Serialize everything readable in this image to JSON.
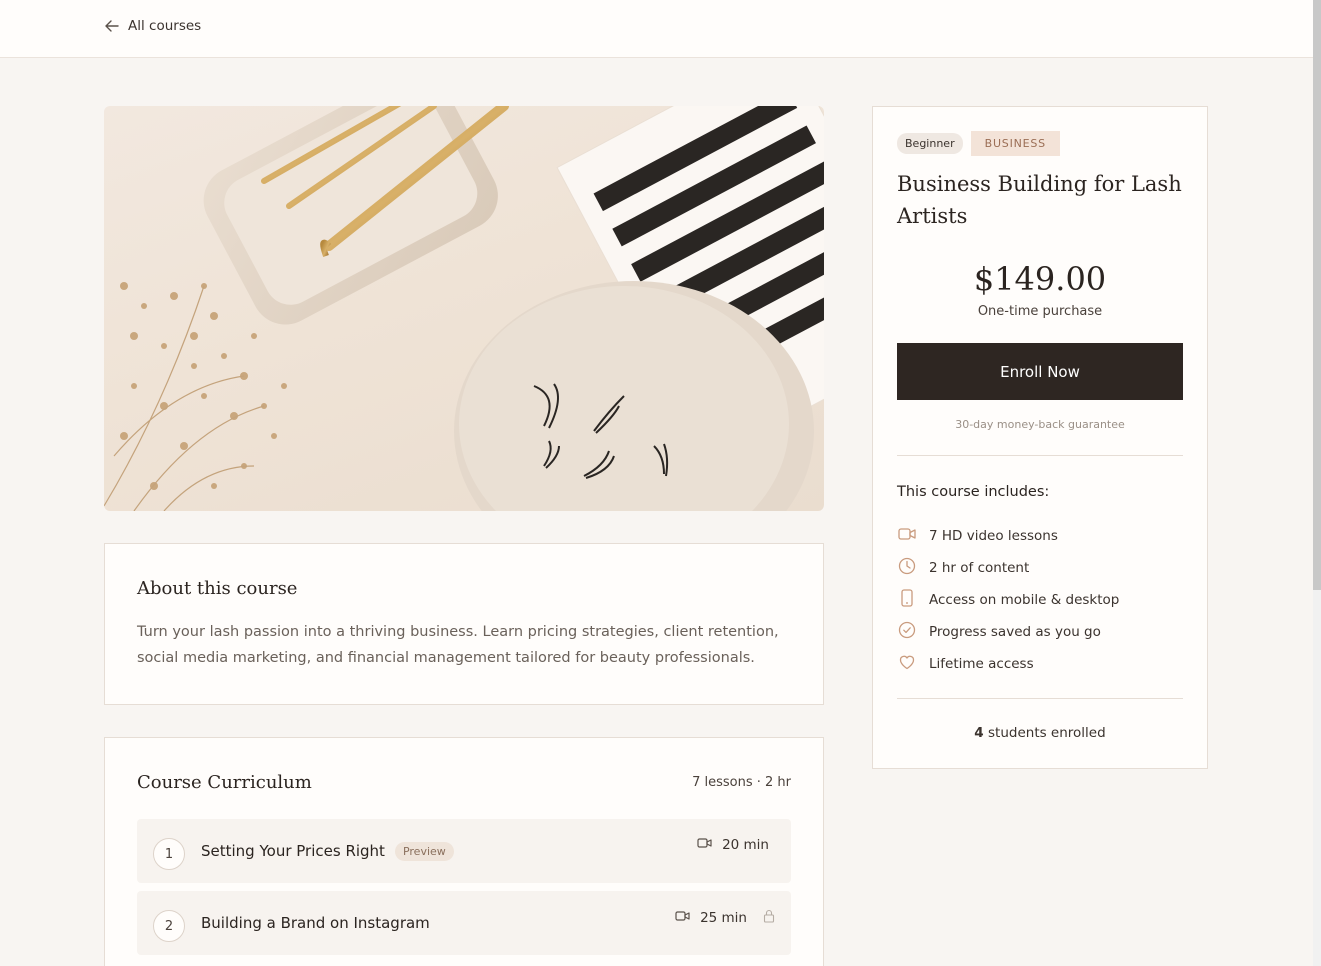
{
  "nav": {
    "back_label": "All courses"
  },
  "about": {
    "heading": "About this course",
    "description": "Turn your lash passion into a thriving business. Learn pricing strategies, client retention, social media marketing, and financial management tailored for beauty professionals."
  },
  "curriculum": {
    "heading": "Course Curriculum",
    "meta": "7 lessons · 2 hr",
    "lessons": [
      {
        "number": "1",
        "title": "Setting Your Prices Right",
        "badge": "Preview",
        "duration": "20 min",
        "locked": false
      },
      {
        "number": "2",
        "title": "Building a Brand on Instagram",
        "badge": "",
        "duration": "25 min",
        "locked": true
      }
    ]
  },
  "sidebar": {
    "level": "Beginner",
    "category": "BUSINESS",
    "title": "Business Building for Lash Artists",
    "price": "$149.00",
    "price_note": "One-time purchase",
    "enroll_label": "Enroll Now",
    "guarantee": "30-day money-back guarantee",
    "includes_title": "This course includes:",
    "includes": [
      {
        "icon": "video-icon",
        "label": "7 HD video lessons"
      },
      {
        "icon": "clock-icon",
        "label": "2 hr of content"
      },
      {
        "icon": "mobile-icon",
        "label": "Access on mobile & desktop"
      },
      {
        "icon": "check-circle-icon",
        "label": "Progress saved as you go"
      },
      {
        "icon": "heart-icon",
        "label": "Lifetime access"
      }
    ],
    "students_count": "4",
    "students_label": "students enrolled"
  },
  "colors": {
    "accent": "#b98a6c",
    "button": "#2e2622",
    "background": "#f8f5f2"
  }
}
